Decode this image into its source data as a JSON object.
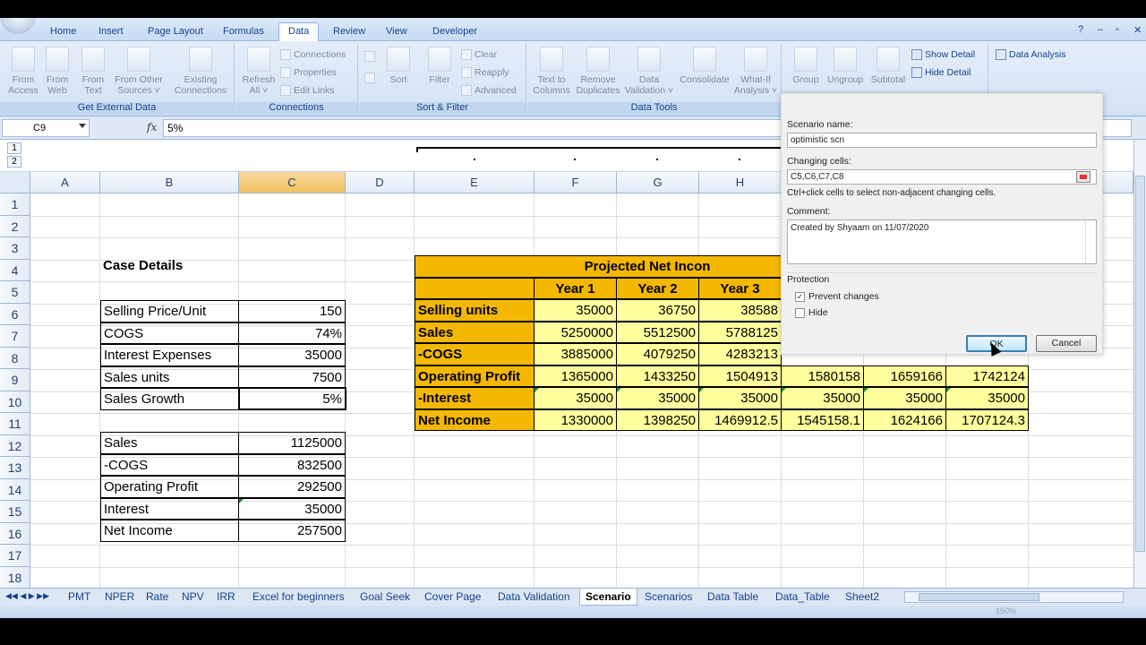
{
  "ribbon": {
    "tabs": [
      "Home",
      "Insert",
      "Page Layout",
      "Formulas",
      "Data",
      "Review",
      "View",
      "Developer"
    ],
    "active_tab": "Data",
    "groups": {
      "get_external_data": {
        "label": "Get External Data",
        "buttons": [
          {
            "l1": "From",
            "l2": "Access"
          },
          {
            "l1": "From",
            "l2": "Web"
          },
          {
            "l1": "From",
            "l2": "Text"
          },
          {
            "l1": "From Other",
            "l2": "Sources ˅"
          },
          {
            "l1": "Existing",
            "l2": "Connections"
          }
        ]
      },
      "connections": {
        "label": "Connections",
        "refresh": {
          "l1": "Refresh",
          "l2": "All ˅"
        },
        "items": [
          "Connections",
          "Properties",
          "Edit Links"
        ]
      },
      "sort_filter": {
        "label": "Sort & Filter",
        "sort": "Sort",
        "filter": "Filter",
        "items": [
          "Clear",
          "Reapply",
          "Advanced"
        ]
      },
      "data_tools": {
        "label": "Data Tools",
        "buttons": [
          {
            "l1": "Text to",
            "l2": "Columns"
          },
          {
            "l1": "Remove",
            "l2": "Duplicates"
          },
          {
            "l1": "Data",
            "l2": "Validation ˅"
          },
          {
            "l1": "Consolidate",
            "l2": ""
          },
          {
            "l1": "What-If",
            "l2": "Analysis ˅"
          }
        ]
      },
      "outline": {
        "buttons": [
          "Group",
          "Ungroup",
          "Subtotal"
        ],
        "show_detail": "Show Detail",
        "hide_detail": "Hide Detail"
      },
      "analysis": {
        "data_analysis": "Data Analysis"
      }
    }
  },
  "formula_bar": {
    "name_box": "C9",
    "fx": "fx",
    "formula": "5%"
  },
  "outline_levels": [
    "1",
    "2"
  ],
  "columns": [
    "A",
    "B",
    "C",
    "D",
    "E",
    "F",
    "G",
    "H"
  ],
  "selected_column": "C",
  "rows": [
    "1",
    "2",
    "3",
    "4",
    "5",
    "6",
    "7",
    "8",
    "9",
    "10",
    "11",
    "12",
    "13",
    "14",
    "15",
    "16",
    "17",
    "18"
  ],
  "case_details": {
    "title": "Case Details",
    "inputs": [
      {
        "label": "Selling Price/Unit",
        "value": "150"
      },
      {
        "label": "COGS",
        "value": "74%"
      },
      {
        "label": "Interest Expenses",
        "value": "35000"
      },
      {
        "label": "Sales units",
        "value": "7500"
      },
      {
        "label": "Sales Growth",
        "value": "5%"
      }
    ],
    "results": [
      {
        "label": "Sales",
        "value": "1125000"
      },
      {
        "label": "-COGS",
        "value": "832500"
      },
      {
        "label": "Operating Profit",
        "value": "292500"
      },
      {
        "label": "Interest",
        "value": "35000"
      },
      {
        "label": "Net Income",
        "value": "257500"
      }
    ]
  },
  "projection": {
    "title": "Projected Net Incon",
    "years": [
      "Year 1",
      "Year 2",
      "Year 3"
    ],
    "rows": [
      {
        "label": "Selling units",
        "values": [
          "35000",
          "36750",
          "38588",
          "",
          "",
          ""
        ]
      },
      {
        "label": "Sales",
        "values": [
          "5250000",
          "5512500",
          "5788125",
          "",
          "",
          ""
        ]
      },
      {
        "label": "-COGS",
        "values": [
          "3885000",
          "4079250",
          "4283213",
          "",
          "",
          ""
        ]
      },
      {
        "label": "Operating Profit",
        "values": [
          "1365000",
          "1433250",
          "1504913",
          "1580158",
          "1659166",
          "1742124"
        ]
      },
      {
        "label": "-Interest",
        "values": [
          "35000",
          "35000",
          "35000",
          "35000",
          "35000",
          "35000"
        ]
      },
      {
        "label": "Net Income",
        "values": [
          "1330000",
          "1398250",
          "1469912.5",
          "1545158.1",
          "1624166",
          "1707124.3"
        ]
      }
    ]
  },
  "sheet_tabs": [
    "PMT",
    "NPER",
    "Rate",
    "NPV",
    "IRR",
    "Excel for beginners",
    "Goal Seek",
    "Cover Page",
    "Data Validation",
    "Scenario",
    "Scenarios",
    "Data Table",
    "Data_Table",
    "Sheet2"
  ],
  "active_sheet": "Scenario",
  "dialog": {
    "scenario_name_label": "Scenario name:",
    "scenario_name": "optimistic scn",
    "changing_cells_label": "Changing cells:",
    "changing_cells": "C5,C6,C7,C8",
    "hint": "Ctrl+click cells to select non-adjacent changing cells.",
    "comment_label": "Comment:",
    "comment": "Created by Shyaam on 11/07/2020",
    "protection_label": "Protection",
    "prevent_changes": "Prevent changes",
    "prevent_changes_checked": true,
    "hide": "Hide",
    "hide_checked": false,
    "ok": "OK",
    "cancel": "Cancel"
  },
  "status": {
    "zoom": "150%"
  }
}
